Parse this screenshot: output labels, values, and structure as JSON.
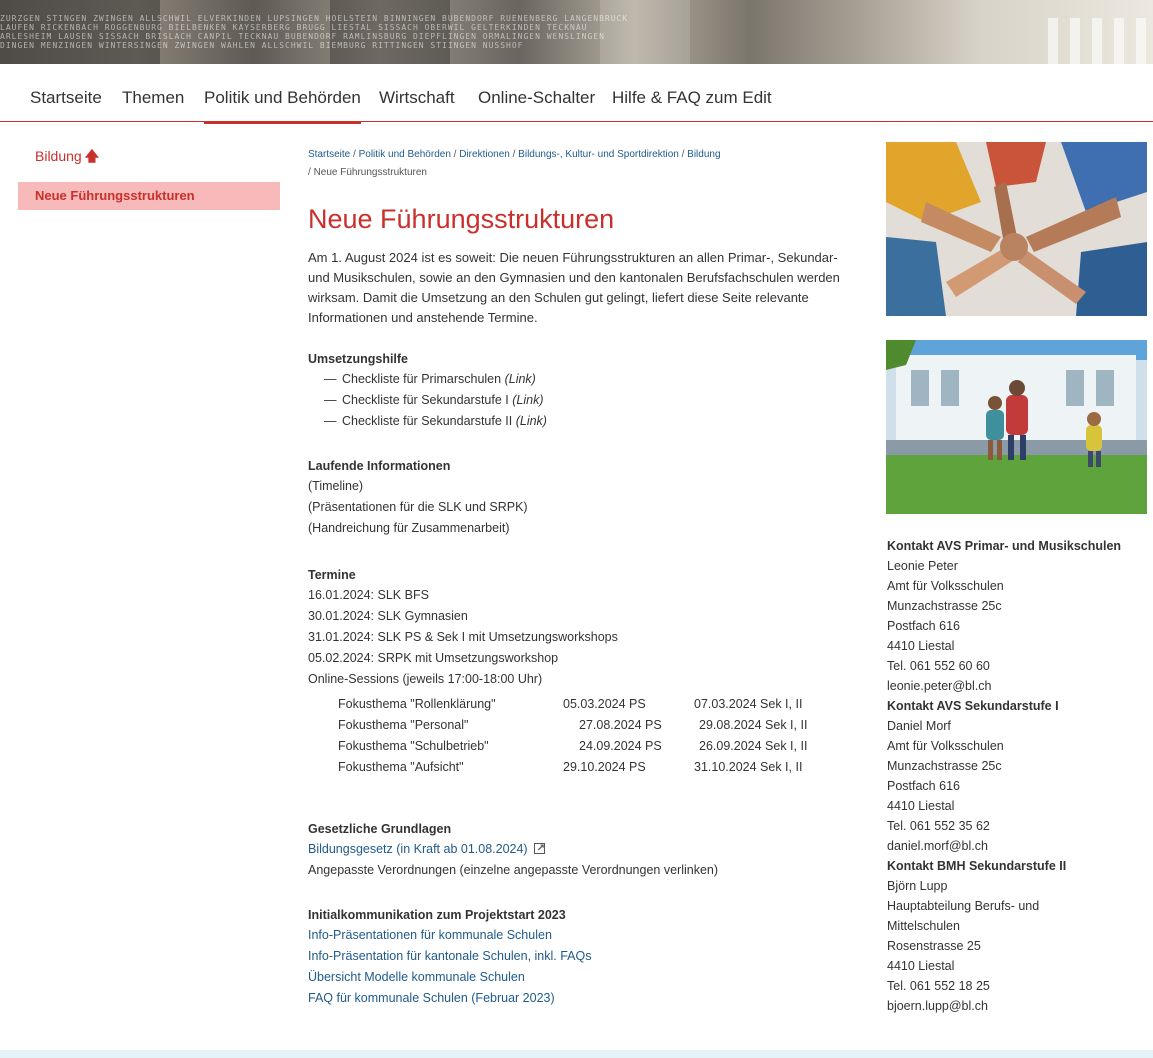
{
  "banner": {
    "lines": [
      "ZURZGEN STINGEN ZWINGEN ALLSCHWIL ELVERKINDEN LUPSINGEN HOELSTEIN BINNINGEN BUBENDORF RUENENBERG LANGENBRUCK",
      "LAUFEN RICKENBACH ROGGENBURG BIELBENKEN KAYSERBERG BRUGG LIESTAL SISSACH OBERWIL GELTERKINDEN TECKNAU",
      "ARLESHEIM LAUSEN SISSACH BRISLACH CANPIL TECKNAU BUBENDORF RAMLINSBURG DIEPFLINGEN ORMALINGEN WENSLINGEN",
      "DINGEN MENZINGEN WINTERSINGEN ZWINGEN WAHLEN ALLSCHWIL BIEMBURG RITTINGEN STIINGEN NUSSHOF"
    ]
  },
  "nav": {
    "items": [
      "Startseite",
      "Themen",
      "Politik und Behörden",
      "Wirtschaft",
      "Online-Schalter",
      "Hilfe & FAQ zum Edit"
    ]
  },
  "sidebar": {
    "back_label": "Bildung",
    "current_label": "Neue Führungsstrukturen"
  },
  "breadcrumb": {
    "links": [
      "Startseite",
      "Politik und Behörden",
      "Direktionen",
      "Bildungs-, Kultur- und Sportdirektion",
      "Bildung"
    ],
    "current": "Neue Führungsstrukturen"
  },
  "page": {
    "title": "Neue Führungsstrukturen",
    "intro": "Am 1. August 2024 ist es soweit: Die neuen Führungsstrukturen an allen Primar-, Sekundar- und Musikschulen, sowie an den Gymnasien und den kantonalen Berufsfachschulen werden wirksam. Damit die Umsetzung an den Schulen gut gelingt, liefert diese Seite relevante Informationen und anstehende Termine."
  },
  "umsetzungshilfe": {
    "heading": "Umsetzungshilfe",
    "items": [
      {
        "text": "Checkliste für Primarschulen",
        "note": "(Link)"
      },
      {
        "text": "Checkliste für Sekundarstufe I",
        "note": "(Link)"
      },
      {
        "text": "Checkliste für Sekundarstufe II",
        "note": "(Link)"
      }
    ]
  },
  "laufende": {
    "heading": "Laufende Informationen",
    "items": [
      "(Timeline)",
      "(Präsentationen für die SLK und SRPK)",
      "(Handreichung für Zusammenarbeit)"
    ]
  },
  "termine": {
    "heading": "Termine",
    "items": [
      "16.01.2024: SLK BFS",
      "30.01.2024: SLK Gymnasien",
      "31.01.2024: SLK PS & Sek I mit Umsetzungsworkshops",
      "05.02.2024: SRPK mit Umsetzungsworkshop",
      "Online-Sessions (jeweils 17:00-18:00 Uhr)"
    ],
    "fokus": [
      {
        "topic": "Fokusthema \"Rollenklärung\"",
        "ps": "05.03.2024 PS",
        "sek": "07.03.2024 Sek I, II"
      },
      {
        "topic": "Fokusthema \"Personal\"",
        "ps": "27.08.2024 PS",
        "sek": "29.08.2024 Sek I, II"
      },
      {
        "topic": "Fokusthema \"Schulbetrieb\"",
        "ps": "24.09.2024 PS",
        "sek": "26.09.2024 Sek I, II"
      },
      {
        "topic": "Fokusthema \"Aufsicht\"",
        "ps": "29.10.2024 PS",
        "sek": "31.10.2024 Sek I, II"
      }
    ]
  },
  "grundlagen": {
    "heading": "Gesetzliche Grundlagen",
    "link": "Bildungsgesetz (in Kraft ab 01.08.2024)",
    "text": "Angepasste Verordnungen (einzelne angepasste Verordnungen verlinken)"
  },
  "initial": {
    "heading": "Initialkommunikation zum Projektstart 2023",
    "links": [
      "Info-Präsentationen für kommunale Schulen",
      "Info-Präsentation für kantonale Schulen, inkl. FAQs",
      "Übersicht Modelle kommunale Schulen",
      "FAQ für kommunale Schulen (Februar 2023)"
    ]
  },
  "contacts": [
    {
      "heading": "Kontakt AVS Primar- und Musikschulen",
      "lines": [
        "Leonie Peter",
        "Amt für Volksschulen",
        "Munzachstrasse 25c",
        "Postfach 616",
        "4410 Liestal",
        "Tel. 061 552 60 60",
        "leonie.peter@bl.ch"
      ]
    },
    {
      "heading": "Kontakt AVS Sekundarstufe I",
      "lines": [
        "Daniel Morf",
        "Amt für Volksschulen",
        "Munzachstrasse 25c",
        "Postfach 616",
        "4410 Liestal",
        "Tel. 061 552 35 62",
        "daniel.morf@bl.ch"
      ]
    },
    {
      "heading": "Kontakt BMH Sekundarstufe II",
      "lines": [
        "Björn Lupp",
        "Hauptabteilung Berufs- und",
        "Mittelschulen",
        "Rosenstrasse 25",
        "4410 Liestal",
        "Tel. 061 552 18 25",
        "bjoern.lupp@bl.ch"
      ]
    }
  ],
  "colors": {
    "accent": "#c9302c",
    "link": "#1f5a8a",
    "sidebar_active_bg": "#f7b9b9"
  },
  "icons": {
    "back": "arrow-up-icon",
    "external": "external-link-icon"
  }
}
